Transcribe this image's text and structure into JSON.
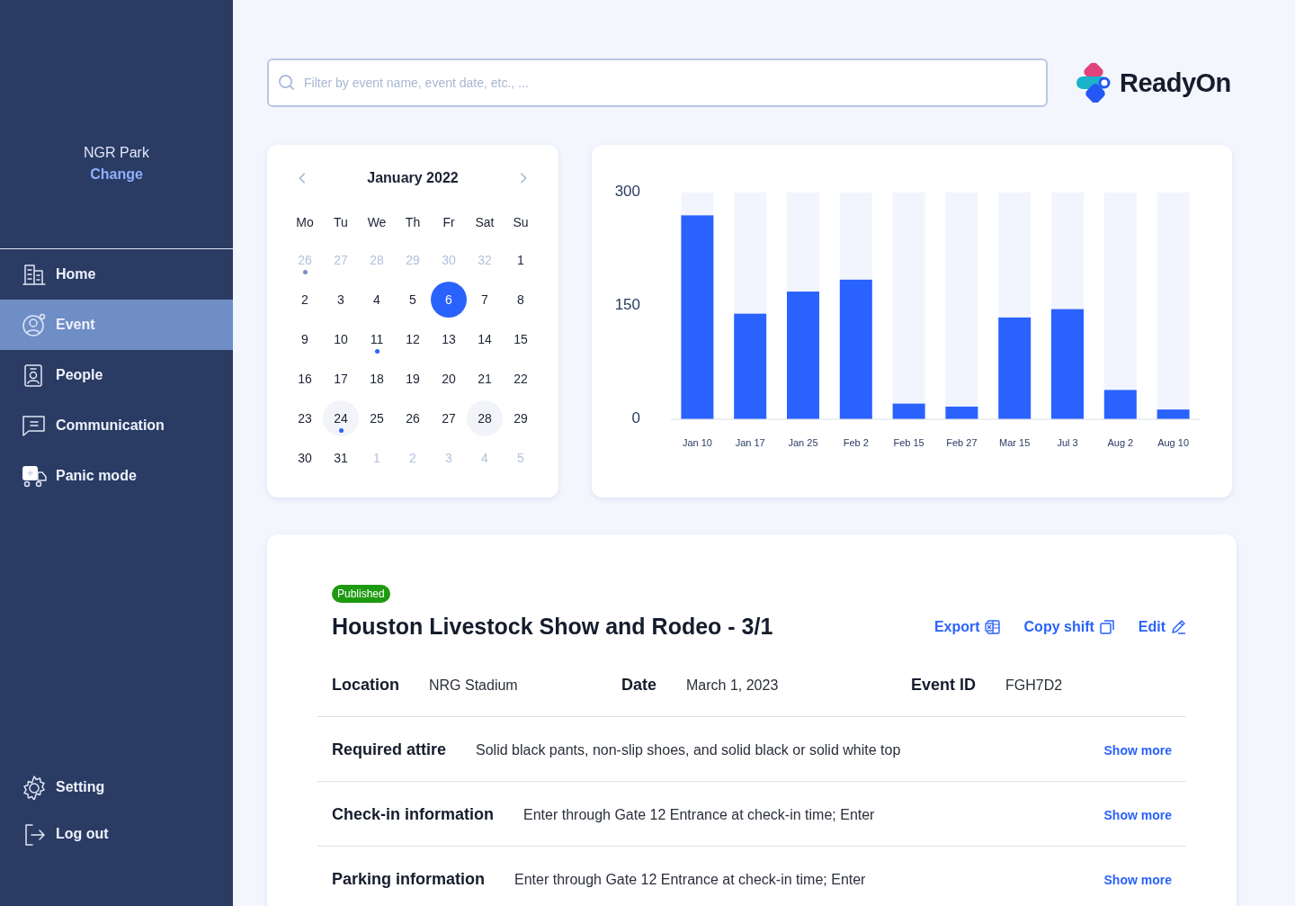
{
  "sidebar": {
    "venue": "NGR Park",
    "change_link": "Change",
    "items": [
      {
        "kind": "home",
        "label": "Home",
        "selected": false
      },
      {
        "kind": "event",
        "label": "Event",
        "selected": true
      },
      {
        "kind": "people",
        "label": "People",
        "selected": false
      },
      {
        "kind": "communication",
        "label": "Communication",
        "selected": false
      },
      {
        "kind": "panic",
        "label": "Panic mode",
        "selected": false
      }
    ],
    "bottom_items": [
      {
        "kind": "setting",
        "label": "Setting"
      },
      {
        "kind": "logout",
        "label": "Log out"
      }
    ]
  },
  "search": {
    "placeholder": "Filter by event name, event date, etc., ..."
  },
  "logo": {
    "text": "ReadyOn"
  },
  "calendar": {
    "month": "January 2022",
    "weekdays": [
      "Mo",
      "Tu",
      "We",
      "Th",
      "Fr",
      "Sat",
      "Su"
    ],
    "days": [
      {
        "label": "26",
        "muted": true,
        "selected": false,
        "dot": true,
        "highlighted": false
      },
      {
        "label": "27",
        "muted": true,
        "selected": false,
        "dot": false,
        "highlighted": false
      },
      {
        "label": "28",
        "muted": true,
        "selected": false,
        "dot": false,
        "highlighted": false
      },
      {
        "label": "29",
        "muted": true,
        "selected": false,
        "dot": false,
        "highlighted": false
      },
      {
        "label": "30",
        "muted": true,
        "selected": false,
        "dot": false,
        "highlighted": false
      },
      {
        "label": "32",
        "muted": true,
        "selected": false,
        "dot": false,
        "highlighted": false
      },
      {
        "label": "1",
        "muted": false,
        "selected": false,
        "dot": false,
        "highlighted": false
      },
      {
        "label": "2",
        "muted": false,
        "selected": false,
        "dot": false,
        "highlighted": false
      },
      {
        "label": "3",
        "muted": false,
        "selected": false,
        "dot": false,
        "highlighted": false
      },
      {
        "label": "4",
        "muted": false,
        "selected": false,
        "dot": false,
        "highlighted": false
      },
      {
        "label": "5",
        "muted": false,
        "selected": false,
        "dot": false,
        "highlighted": false
      },
      {
        "label": "6",
        "muted": false,
        "selected": true,
        "dot": false,
        "highlighted": false
      },
      {
        "label": "7",
        "muted": false,
        "selected": false,
        "dot": false,
        "highlighted": false
      },
      {
        "label": "8",
        "muted": false,
        "selected": false,
        "dot": false,
        "highlighted": false
      },
      {
        "label": "9",
        "muted": false,
        "selected": false,
        "dot": false,
        "highlighted": false
      },
      {
        "label": "10",
        "muted": false,
        "selected": false,
        "dot": false,
        "highlighted": false
      },
      {
        "label": "11",
        "muted": false,
        "selected": false,
        "dot": true,
        "highlighted": false
      },
      {
        "label": "12",
        "muted": false,
        "selected": false,
        "dot": false,
        "highlighted": false
      },
      {
        "label": "13",
        "muted": false,
        "selected": false,
        "dot": false,
        "highlighted": false
      },
      {
        "label": "14",
        "muted": false,
        "selected": false,
        "dot": false,
        "highlighted": false
      },
      {
        "label": "15",
        "muted": false,
        "selected": false,
        "dot": false,
        "highlighted": false
      },
      {
        "label": "16",
        "muted": false,
        "selected": false,
        "dot": false,
        "highlighted": false
      },
      {
        "label": "17",
        "muted": false,
        "selected": false,
        "dot": false,
        "highlighted": false
      },
      {
        "label": "18",
        "muted": false,
        "selected": false,
        "dot": false,
        "highlighted": false
      },
      {
        "label": "19",
        "muted": false,
        "selected": false,
        "dot": false,
        "highlighted": false
      },
      {
        "label": "20",
        "muted": false,
        "selected": false,
        "dot": false,
        "highlighted": false
      },
      {
        "label": "21",
        "muted": false,
        "selected": false,
        "dot": false,
        "highlighted": false
      },
      {
        "label": "22",
        "muted": false,
        "selected": false,
        "dot": false,
        "highlighted": false
      },
      {
        "label": "23",
        "muted": false,
        "selected": false,
        "dot": false,
        "highlighted": false
      },
      {
        "label": "24",
        "muted": false,
        "selected": false,
        "dot": true,
        "highlighted": true
      },
      {
        "label": "25",
        "muted": false,
        "selected": false,
        "dot": false,
        "highlighted": false
      },
      {
        "label": "26",
        "muted": false,
        "selected": false,
        "dot": false,
        "highlighted": false
      },
      {
        "label": "27",
        "muted": false,
        "selected": false,
        "dot": false,
        "highlighted": false
      },
      {
        "label": "28",
        "muted": false,
        "selected": false,
        "dot": false,
        "highlighted": true
      },
      {
        "label": "29",
        "muted": false,
        "selected": false,
        "dot": false,
        "highlighted": false
      },
      {
        "label": "30",
        "muted": false,
        "selected": false,
        "dot": false,
        "highlighted": false
      },
      {
        "label": "31",
        "muted": false,
        "selected": false,
        "dot": false,
        "highlighted": false
      },
      {
        "label": "1",
        "muted": true,
        "selected": false,
        "dot": false,
        "highlighted": false
      },
      {
        "label": "2",
        "muted": true,
        "selected": false,
        "dot": false,
        "highlighted": false
      },
      {
        "label": "3",
        "muted": true,
        "selected": false,
        "dot": false,
        "highlighted": false
      },
      {
        "label": "4",
        "muted": true,
        "selected": false,
        "dot": false,
        "highlighted": false
      },
      {
        "label": "5",
        "muted": true,
        "selected": false,
        "dot": false,
        "highlighted": false
      }
    ]
  },
  "chart": {
    "chart_data": {
      "type": "bar",
      "categories": [
        "Jan 10",
        "Jan 17",
        "Jan 25",
        "Feb 2",
        "Feb 15",
        "Feb 27",
        "Mar 15",
        "Jul 3",
        "Aug 2",
        "Aug 10"
      ],
      "stacked": true,
      "series": [
        {
          "color": "#2a62fe",
          "values": [
            270,
            140,
            169,
            185,
            21,
            17,
            135,
            146,
            39,
            13
          ]
        },
        {
          "color": "#f2f5fe",
          "values": [
            30,
            160,
            131,
            115,
            279,
            283,
            165,
            154,
            261,
            287
          ]
        }
      ],
      "ylim": [
        0,
        300
      ],
      "yticks": [
        0,
        150,
        300
      ]
    }
  },
  "event": {
    "status": "Published",
    "title": "Houston Livestock Show and Rodeo - 3/1",
    "actions": [
      {
        "kind": "export",
        "label": "Export"
      },
      {
        "kind": "copy",
        "label": "Copy shift"
      },
      {
        "kind": "edit",
        "label": "Edit"
      }
    ],
    "fields": [
      {
        "label": "Location",
        "value": "NRG Stadium"
      },
      {
        "label": "Date",
        "value": "March 1, 2023"
      },
      {
        "label": "Event ID",
        "value": "FGH7D2"
      }
    ],
    "details": [
      {
        "label": "Required attire",
        "value": "Solid black pants, non-slip shoes, and solid black or solid white top",
        "link": "Show more"
      },
      {
        "label": "Check-in information",
        "value": "Enter through Gate 12 Entrance  at check-in time; Enter",
        "link": "Show more"
      },
      {
        "label": "Parking information",
        "value": "Enter through Gate 12 Entrance  at check-in time; Enter",
        "link": "Show more"
      }
    ]
  }
}
